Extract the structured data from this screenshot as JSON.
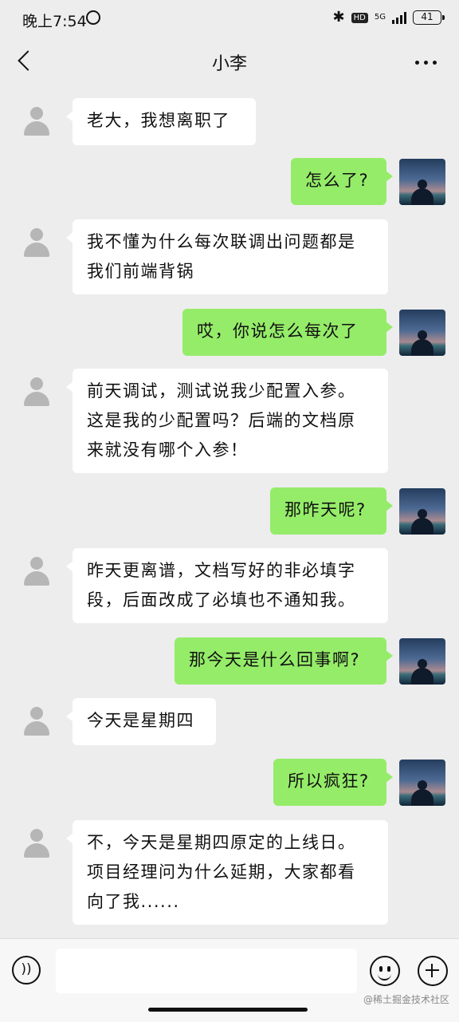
{
  "status_bar": {
    "time": "晚上7:54",
    "hd": "HD",
    "network": "5G",
    "battery": "41"
  },
  "header": {
    "title": "小李"
  },
  "messages": [
    {
      "side": "in",
      "text": "老大，我想离职了"
    },
    {
      "side": "out",
      "text": "怎么了?"
    },
    {
      "side": "in",
      "text": "我不懂为什么每次联调出问题都是\n我们前端背锅"
    },
    {
      "side": "out",
      "text": "哎，你说怎么每次了"
    },
    {
      "side": "in",
      "text": "前天调试，测试说我少配置入参。\n这是我的少配置吗？后端的文档原\n来就没有哪个入参！"
    },
    {
      "side": "out",
      "text": "那昨天呢?"
    },
    {
      "side": "in",
      "text": "昨天更离谱，文档写好的非必填字\n段，后面改成了必填也不通知我。"
    },
    {
      "side": "out",
      "text": "那今天是什么回事啊?"
    },
    {
      "side": "in",
      "text": "今天是星期四"
    },
    {
      "side": "out",
      "text": "所以疯狂?"
    },
    {
      "side": "in",
      "text": "不，今天是星期四原定的上线日。\n项目经理问为什么延期，大家都看\n向了我......"
    }
  ],
  "input_bar": {
    "value": ""
  },
  "watermark": "@稀土掘金技术社区",
  "colors": {
    "background": "#ededed",
    "incoming_bubble": "#ffffff",
    "outgoing_bubble": "#95ec69"
  }
}
